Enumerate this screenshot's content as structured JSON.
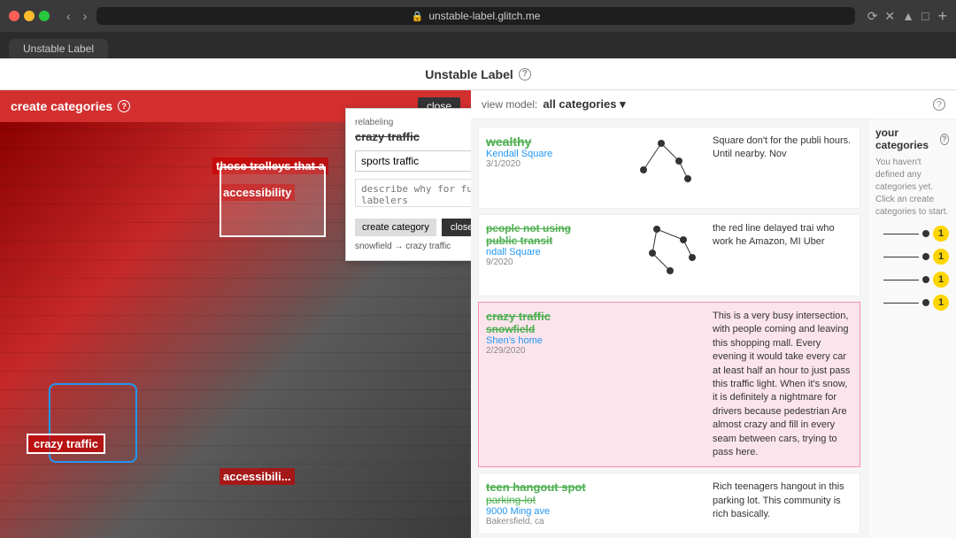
{
  "browser": {
    "url": "unstable-label.glitch.me",
    "tab_label": "Unstable Label"
  },
  "app": {
    "title": "Unstable Label",
    "help_icon": "?"
  },
  "left_panel": {
    "title": "create categories",
    "help_icon": "?",
    "close_btn": "close",
    "annotations": {
      "crazy_traffic": "crazy traffic",
      "trolleys": "those trolleys that a",
      "accessibility": "accessibility",
      "accessibility2": "accessibili..."
    }
  },
  "relabeling_popup": {
    "label": "relabeling",
    "original_text": "crazy traffic",
    "input_value": "sports traffic",
    "input_placeholder": "sports traffic",
    "describe_placeholder": "describe why for future labelers",
    "create_btn": "create category",
    "close_btn": "close",
    "footer": "snowfield → crazy traffic"
  },
  "right_panel": {
    "view_model_label": "view model:",
    "view_model_value": "all categories ▾",
    "help_icon": "?"
  },
  "your_categories": {
    "title": "your categories",
    "help_icon": "?",
    "empty_text": "You haven't defined any categories yet. Click an create categories to start."
  },
  "cards": [
    {
      "label_main": "wealthy",
      "label_sub": "",
      "location": "Kendall Square",
      "date": "3/1/2020",
      "description": "Square don't for the publi hours. Until nearby. Nov"
    },
    {
      "label_main": "people not using public transit",
      "label_sub": "",
      "location": "ndall Square",
      "date": "9/2020",
      "description": "the red line delayed trai who work he Amazon, MI Uber"
    },
    {
      "label_main": "crazy traffic",
      "label_sub": "snowfield",
      "location": "Shen's home",
      "date": "2/29/2020",
      "highlighted": true,
      "description": "This is a very busy intersection, with people coming and leaving this shopping mall. Every evening it would take every car at least half an hour to just pass this traffic light. When it's snow, it is definitely a nightmare for drivers because pedestrian Are almost crazy and fill in every seam between cars, trying to pass here."
    },
    {
      "label_main": "teen hangout spot",
      "label_sub": "parking-lot",
      "location": "9000 Ming ave",
      "date": "Bakersfield, ca",
      "description": "Rich teenagers hangout in this parking lot. This community is rich basically."
    }
  ],
  "badges": [
    "1",
    "1",
    "1",
    "1"
  ]
}
